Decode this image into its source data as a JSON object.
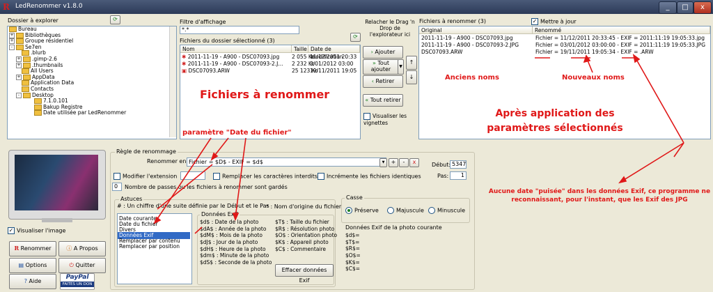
{
  "window": {
    "title": "LedRenommer v1.8.0",
    "app_icon": "R",
    "minimize": "_",
    "maximize": "□",
    "close": "x"
  },
  "explorer": {
    "label": "Dossier à explorer",
    "tree": [
      "Bureau",
      "Bibliothèques",
      "Groupe résidentiel",
      "Se7en",
      ".blurb",
      ".gimp-2.6",
      ".thumbnails",
      "All Users",
      "AppData",
      "Application Data",
      "Contacts",
      "Desktop",
      "7.1.0.101",
      "Bakup Registre",
      "Date utilisée par LedRenommer"
    ]
  },
  "filter": {
    "label": "Filtre d'affichage",
    "value": "*.*"
  },
  "selected_files": {
    "label": "Fichiers du dossier sélectionné (3)",
    "columns": [
      "Nom",
      "Taille",
      "Date de modification"
    ],
    "rows": [
      {
        "name": "2011-11-19 - A900 - DSC07093.jpg",
        "size": "2 055 Ko",
        "date": "11/12/2011 20:33"
      },
      {
        "name": "2011-11-19 - A900 - DSC07093-2.J...",
        "size": "2 232 Ko",
        "date": "3/01/2012 03:00"
      },
      {
        "name": "DSC07093.ARW",
        "size": "25 123 Ko",
        "date": "19/11/2011 19:05"
      }
    ]
  },
  "drag_panel": {
    "hint": "Relacher le Drag 'n Drop de l'explorateur ici",
    "add": "Ajouter",
    "add_all": "Tout ajouter",
    "remove": "Retirer",
    "remove_all": "Tout retirer",
    "thumbs": "Visualiser les vignettes"
  },
  "rename_panel": {
    "label": "Fichiers à renommer (3)",
    "update": "Mettre à jour",
    "columns": [
      "Original",
      "Renommé"
    ],
    "rows": [
      {
        "orig": "2011-11-19 - A900 - DSC07093.jpg",
        "new": "Fichier = 11/12/2011 20:33:45  -  EXIF = 2011:11:19 19:05:33.jpg"
      },
      {
        "orig": "2011-11-19 - A900 - DSC07093-2.JPG",
        "new": "Fichier = 03/01/2012 03:00:00  -  EXIF = 2011:11:19 19:05:33.JPG"
      },
      {
        "orig": "DSC07093.ARW",
        "new": "Fichier = 19/11/2011 19:05:34  -  EXIF = .ARW"
      }
    ]
  },
  "rule": {
    "title": "Règle de renommage",
    "rename_in": "Renommer en:",
    "pattern": "Fichier = $D$  -  EXIF = $d$",
    "plus": "+",
    "minus": "-",
    "clear": "x",
    "start_label": "Début:",
    "start": "5347",
    "step_label": "Pas:",
    "step": "1",
    "modify_ext": "Modifier l'extension",
    "replace_forbidden": "Remplacer les caractères interdits",
    "increment": "Incrémente les fichiers identiques",
    "passes_value": "0",
    "passes_text": "Nombre de passes ou les fichiers à renommer sont gardés"
  },
  "tips": {
    "title": "Astuces",
    "line1": "# : Un chiffre d'une suite définie par le Début et le Pas",
    "line2": "* : Nom d'origine du fichier",
    "list": [
      "Date courante",
      "Date du fichier",
      "Divers",
      "Données Exif",
      "Remplacer par contenu",
      "Remplacer par position"
    ],
    "selected": 3
  },
  "exif": {
    "title": "Données Exif",
    "left": [
      "$d$ : Date de la photo",
      "$dA$ : Année de la photo",
      "$dM$ : Mois de la photo",
      "$dJ$ : Jour de la photo",
      "$dH$ : Heure de la photo",
      "$dm$ : Minute de la photo",
      "$dS$ : Seconde de la photo"
    ],
    "right": [
      "$T$ : Taille du fichier",
      "$R$ : Résolution photo",
      "$O$ : Orientation photo",
      "$K$ : Appareil photo",
      "$C$ : Commentaire"
    ],
    "clear_btn": "Effacer données Exif"
  },
  "case": {
    "title": "Casse",
    "options": [
      "Préserve",
      "Majuscule",
      "Minuscule"
    ],
    "selected": 0
  },
  "exif_current": {
    "title": "Données Exif de la photo courante",
    "lines": [
      "$d$=",
      "$T$=",
      "$R$=",
      "$O$=",
      "$K$=",
      "$C$="
    ]
  },
  "preview": {
    "visualize": "Visualiser l'image"
  },
  "bottom_buttons": {
    "rename": "Renommer",
    "about": "A Propos",
    "options": "Options",
    "quit": "Quitter",
    "help": "Aide",
    "paypal": "PayPal",
    "paypal_sub": "FAITES UN DON"
  },
  "annotations": {
    "files_to_rename": "Fichiers à renommer",
    "old_names": "Anciens noms",
    "new_names": "Nouveaux noms",
    "after": "Après application des paramètres sélectionnés",
    "param_date": "paramètre \"Date du fichier\"",
    "no_date": "Aucune date \"puisée\" dans les données Exif, ce programme ne reconnaissant, pour l'instant, que les Exif des JPG"
  },
  "colors": {
    "annotation": "#e01818",
    "title_bar": "#3a4866",
    "selection": "#316ac5"
  }
}
